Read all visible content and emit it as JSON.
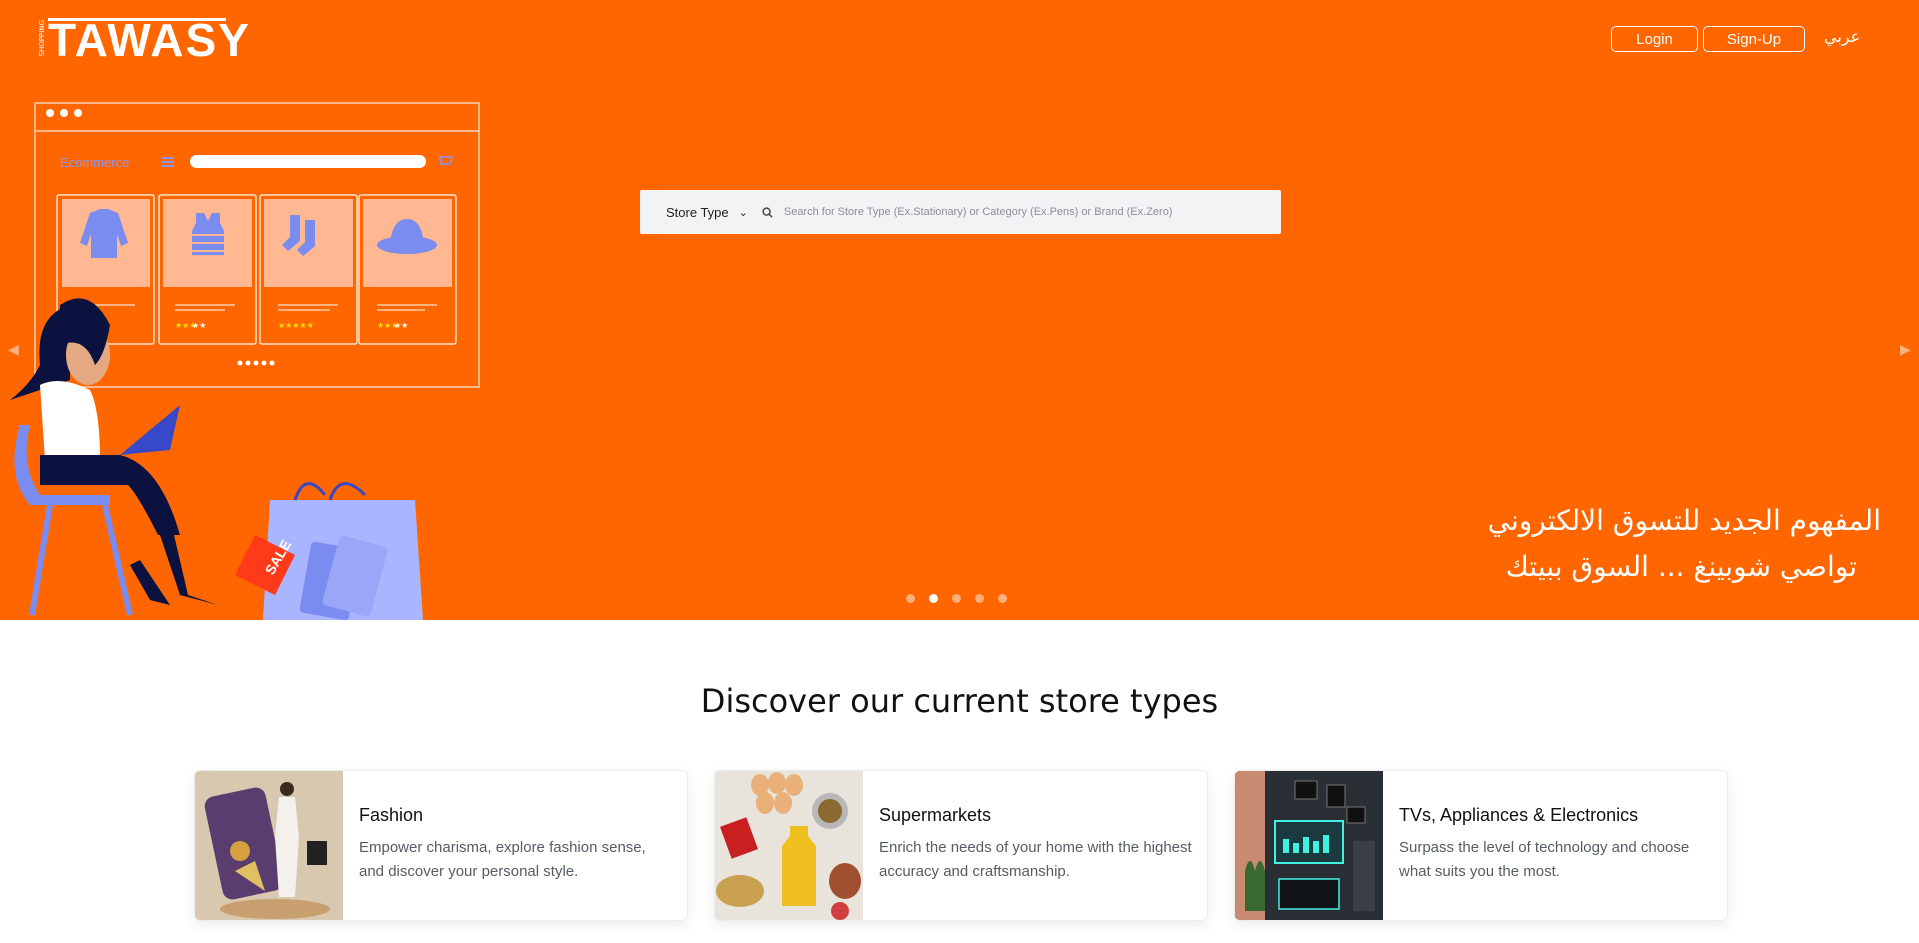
{
  "header": {
    "logo_text": "TAWASY",
    "logo_subtext": "SHOPPING",
    "login_label": "Login",
    "signup_label": "Sign-Up",
    "language_label": "عربي"
  },
  "illustration": {
    "window_title": "Ecommerce",
    "sale_tag": "SALE"
  },
  "search": {
    "store_type_label": "Store Type",
    "placeholder": "Search for Store Type (Ex.Stationary) or Category (Ex.Pens) or Brand (Ex.Zero)"
  },
  "hero": {
    "tagline_line1": "المفهوم الجديد للتسوق الالكتروني",
    "tagline_line2": "تواصي شوبينغ ... السوق ببيتك",
    "active_slide": 2,
    "slide_count": 5
  },
  "section": {
    "title": "Discover our current store types"
  },
  "store_types": [
    {
      "title": "Fashion",
      "description": "Empower charisma, explore fashion sense, and discover your personal style."
    },
    {
      "title": "Supermarkets",
      "description": "Enrich the needs of your home with the highest accuracy and craftsmanship."
    },
    {
      "title": "TVs, Appliances & Electronics",
      "description": "Surpass the level of technology and choose what suits you the most."
    }
  ],
  "colors": {
    "brand_orange": "#ff6600",
    "illustration_blue": "#7b8cf0",
    "navy": "#0b1240"
  }
}
